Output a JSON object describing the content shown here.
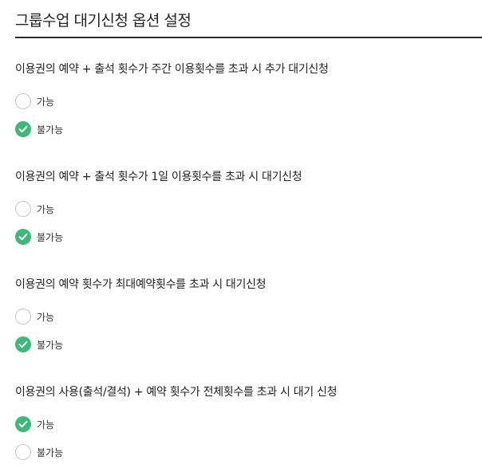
{
  "header": {
    "title": "그룹수업 대기신청 옵션 설정"
  },
  "colors": {
    "accent": "#3cb878",
    "radio_border": "#c8c8c8",
    "divider": "#2b2b2b"
  },
  "sections": [
    {
      "question": "이용권의 예약 + 출석 횟수가 주간 이용횟수를 초과 시 추가 대기신청",
      "options": [
        {
          "label": "가능",
          "checked": false
        },
        {
          "label": "불가능",
          "checked": true
        }
      ]
    },
    {
      "question": "이용권의 예약 + 출석 횟수가 1일 이용횟수를 초과 시 대기신청",
      "options": [
        {
          "label": "가능",
          "checked": false
        },
        {
          "label": "불가능",
          "checked": true
        }
      ]
    },
    {
      "question": "이용권의 예약 횟수가 최대예약횟수를 초과 시 대기신청",
      "options": [
        {
          "label": "가능",
          "checked": false
        },
        {
          "label": "불가능",
          "checked": true
        }
      ]
    },
    {
      "question": "이용권의 사용(출석/결석) + 예약 횟수가 전체횟수를 초과 시 대기 신청",
      "options": [
        {
          "label": "가능",
          "checked": true
        },
        {
          "label": "불가능",
          "checked": false
        }
      ]
    }
  ]
}
